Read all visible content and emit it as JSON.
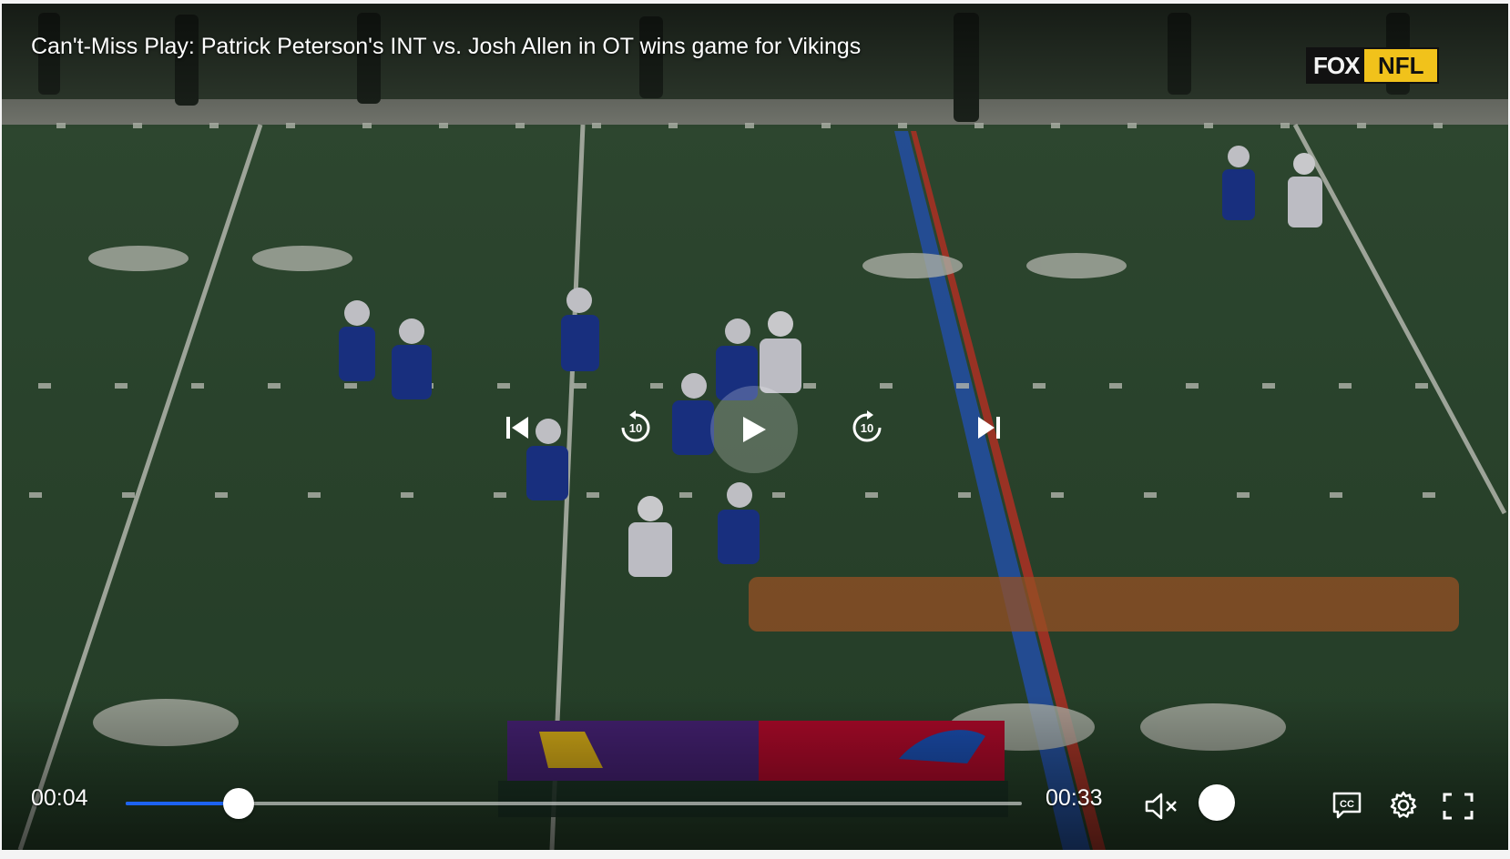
{
  "video": {
    "title": "Can't-Miss Play: Patrick Peterson's INT vs. Josh Allen in OT wins game for Vikings",
    "network_logo": {
      "left": "FOX",
      "right": "NFL"
    }
  },
  "controls": {
    "previous_icon": "skip-previous-icon",
    "rewind_icon": "rewind-10-icon",
    "rewind_label": "10",
    "play_icon": "play-icon",
    "forward_icon": "forward-10-icon",
    "forward_label": "10",
    "next_icon": "skip-next-icon",
    "mute_icon": "speaker-muted-icon",
    "captions_icon": "closed-captions-icon",
    "settings_icon": "gear-icon",
    "fullscreen_icon": "fullscreen-icon"
  },
  "playback": {
    "current_time": "00:04",
    "total_time": "00:33",
    "progress_fraction": 0.126
  },
  "colors": {
    "progress": "#1d63f2",
    "vikings_purple": "#4f2683",
    "bills_red": "#c60c30"
  }
}
